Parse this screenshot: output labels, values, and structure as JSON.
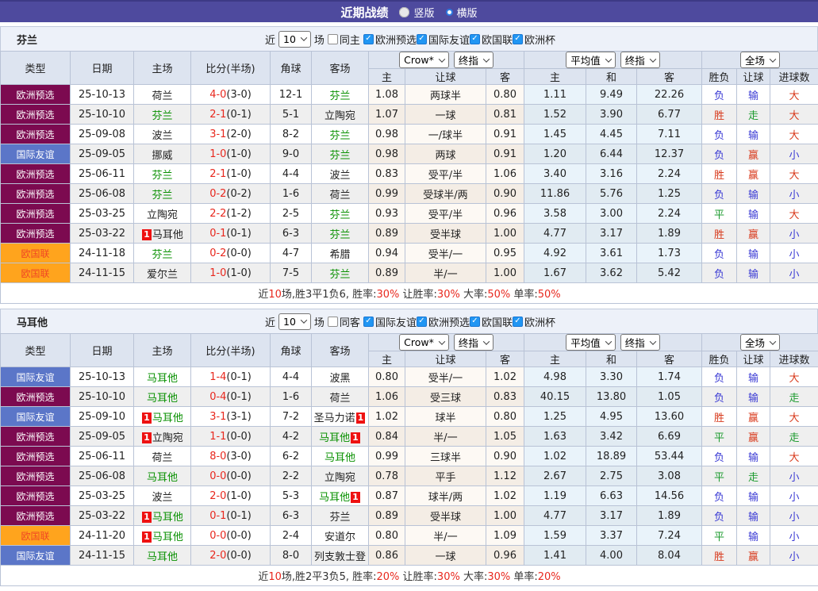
{
  "title_bar": {
    "title": "近期战绩",
    "radios": [
      {
        "label": "竖版",
        "selected": true
      },
      {
        "label": "横版",
        "selected": false
      }
    ]
  },
  "colors": {
    "titlebar_bg": "#4e4a9e",
    "checkbox_blue": "#2196f3",
    "score_red": "#e8281e",
    "team_green": "#089000",
    "badge_red": "#ee1111",
    "header_bg": "#dde4f0"
  },
  "palette": {
    "red": "#d8391b",
    "blue": "#3a3ad4",
    "green": "#1d9b2f"
  },
  "result_colors": {
    "胜": "red",
    "赢": "red",
    "大": "red",
    "负": "blue",
    "输": "blue",
    "小": "blue",
    "平": "green",
    "走": "green"
  },
  "league_styles": {
    "欧洲预选": {
      "bg": "#7c0a50",
      "fg": "#ffffff"
    },
    "国际友谊": {
      "bg": "#5b76c8",
      "fg": "#ffffff"
    },
    "欧国联": {
      "bg": "#ffa41d",
      "fg": "#f04724"
    }
  },
  "table_headers": {
    "cols": [
      "类型",
      "日期",
      "主场",
      "比分(半场)",
      "角球",
      "客场"
    ],
    "group1": {
      "selects": [
        "Crow*",
        "终指"
      ],
      "cols": [
        "主",
        "让球",
        "客"
      ]
    },
    "group2": {
      "selects": [
        "平均值",
        "终指"
      ],
      "cols": [
        "主",
        "和",
        "客"
      ]
    },
    "group3": {
      "selects": [
        "全场"
      ],
      "cols": [
        "胜负",
        "让球",
        "进球数"
      ]
    }
  },
  "tables": [
    {
      "team": "芬兰",
      "filter": {
        "near": "近",
        "count": "10",
        "games": "场",
        "same": "同主",
        "leagues": [
          "欧洲预选",
          "国际友谊",
          "欧国联",
          "欧洲杯"
        ]
      },
      "rows": [
        {
          "lg": "欧洲预选",
          "d": "25-10-13",
          "h": {
            "n": "荷兰"
          },
          "s": "4-0",
          "sh": "(3-0)",
          "c": "12-1",
          "a": {
            "n": "芬兰",
            "g": 1
          },
          "o": [
            "1.08",
            "两球半",
            "0.80"
          ],
          "v": [
            "1.11",
            "9.49",
            "22.26"
          ],
          "r": [
            "负",
            "输",
            "大"
          ]
        },
        {
          "lg": "欧洲预选",
          "d": "25-10-10",
          "h": {
            "n": "芬兰",
            "g": 1
          },
          "s": "2-1",
          "sh": "(0-1)",
          "c": "5-1",
          "a": {
            "n": "立陶宛"
          },
          "o": [
            "1.07",
            "一球",
            "0.81"
          ],
          "v": [
            "1.52",
            "3.90",
            "6.77"
          ],
          "r": [
            "胜",
            "走",
            "大"
          ]
        },
        {
          "lg": "欧洲预选",
          "d": "25-09-08",
          "h": {
            "n": "波兰"
          },
          "s": "3-1",
          "sh": "(2-0)",
          "c": "8-2",
          "a": {
            "n": "芬兰",
            "g": 1
          },
          "o": [
            "0.98",
            "一/球半",
            "0.91"
          ],
          "v": [
            "1.45",
            "4.45",
            "7.11"
          ],
          "r": [
            "负",
            "输",
            "大"
          ]
        },
        {
          "lg": "国际友谊",
          "d": "25-09-05",
          "h": {
            "n": "挪威"
          },
          "s": "1-0",
          "sh": "(1-0)",
          "c": "9-0",
          "a": {
            "n": "芬兰",
            "g": 1
          },
          "o": [
            "0.98",
            "两球",
            "0.91"
          ],
          "v": [
            "1.20",
            "6.44",
            "12.37"
          ],
          "r": [
            "负",
            "赢",
            "小"
          ]
        },
        {
          "lg": "欧洲预选",
          "d": "25-06-11",
          "h": {
            "n": "芬兰",
            "g": 1
          },
          "s": "2-1",
          "sh": "(1-0)",
          "c": "4-4",
          "a": {
            "n": "波兰"
          },
          "o": [
            "0.83",
            "受平/半",
            "1.06"
          ],
          "v": [
            "3.40",
            "3.16",
            "2.24"
          ],
          "r": [
            "胜",
            "赢",
            "大"
          ]
        },
        {
          "lg": "欧洲预选",
          "d": "25-06-08",
          "h": {
            "n": "芬兰",
            "g": 1
          },
          "s": "0-2",
          "sh": "(0-2)",
          "c": "1-6",
          "a": {
            "n": "荷兰"
          },
          "o": [
            "0.99",
            "受球半/两",
            "0.90"
          ],
          "v": [
            "11.86",
            "5.76",
            "1.25"
          ],
          "r": [
            "负",
            "输",
            "小"
          ]
        },
        {
          "lg": "欧洲预选",
          "d": "25-03-25",
          "h": {
            "n": "立陶宛"
          },
          "s": "2-2",
          "sh": "(1-2)",
          "c": "2-5",
          "a": {
            "n": "芬兰",
            "g": 1
          },
          "o": [
            "0.93",
            "受平/半",
            "0.96"
          ],
          "v": [
            "3.58",
            "3.00",
            "2.24"
          ],
          "r": [
            "平",
            "输",
            "大"
          ]
        },
        {
          "lg": "欧洲预选",
          "d": "25-03-22",
          "h": {
            "n": "马耳他",
            "pre": "1"
          },
          "s": "0-1",
          "sh": "(0-1)",
          "c": "6-3",
          "a": {
            "n": "芬兰",
            "g": 1
          },
          "o": [
            "0.89",
            "受半球",
            "1.00"
          ],
          "v": [
            "4.77",
            "3.17",
            "1.89"
          ],
          "r": [
            "胜",
            "赢",
            "小"
          ]
        },
        {
          "lg": "欧国联",
          "d": "24-11-18",
          "h": {
            "n": "芬兰",
            "g": 1
          },
          "s": "0-2",
          "sh": "(0-0)",
          "c": "4-7",
          "a": {
            "n": "希腊"
          },
          "o": [
            "0.94",
            "受半/一",
            "0.95"
          ],
          "v": [
            "4.92",
            "3.61",
            "1.73"
          ],
          "r": [
            "负",
            "输",
            "小"
          ]
        },
        {
          "lg": "欧国联",
          "d": "24-11-15",
          "h": {
            "n": "爱尔兰"
          },
          "s": "1-0",
          "sh": "(1-0)",
          "c": "7-5",
          "a": {
            "n": "芬兰",
            "g": 1
          },
          "o": [
            "0.89",
            "半/一",
            "1.00"
          ],
          "v": [
            "1.67",
            "3.62",
            "5.42"
          ],
          "r": [
            "负",
            "输",
            "小"
          ]
        }
      ],
      "summary": [
        {
          "t": "近",
          "r": 0
        },
        {
          "t": "10",
          "r": 1
        },
        {
          "t": "场,胜3平1负6, 胜率:",
          "r": 0
        },
        {
          "t": "30%",
          "r": 1
        },
        {
          "t": " 让胜率:",
          "r": 0
        },
        {
          "t": "30%",
          "r": 1
        },
        {
          "t": " 大率:",
          "r": 0
        },
        {
          "t": "50%",
          "r": 1
        },
        {
          "t": " 单率:",
          "r": 0
        },
        {
          "t": "50%",
          "r": 1
        }
      ]
    },
    {
      "team": "马耳他",
      "filter": {
        "near": "近",
        "count": "10",
        "games": "场",
        "same": "同客",
        "leagues": [
          "国际友谊",
          "欧洲预选",
          "欧国联",
          "欧洲杯"
        ]
      },
      "rows": [
        {
          "lg": "国际友谊",
          "d": "25-10-13",
          "h": {
            "n": "马耳他",
            "g": 1
          },
          "s": "1-4",
          "sh": "(0-1)",
          "c": "4-4",
          "a": {
            "n": "波黑"
          },
          "o": [
            "0.80",
            "受半/一",
            "1.02"
          ],
          "v": [
            "4.98",
            "3.30",
            "1.74"
          ],
          "r": [
            "负",
            "输",
            "大"
          ]
        },
        {
          "lg": "欧洲预选",
          "d": "25-10-10",
          "h": {
            "n": "马耳他",
            "g": 1
          },
          "s": "0-4",
          "sh": "(0-1)",
          "c": "1-6",
          "a": {
            "n": "荷兰"
          },
          "o": [
            "1.06",
            "受三球",
            "0.83"
          ],
          "v": [
            "40.15",
            "13.80",
            "1.05"
          ],
          "r": [
            "负",
            "输",
            "走"
          ]
        },
        {
          "lg": "国际友谊",
          "d": "25-09-10",
          "h": {
            "n": "马耳他",
            "g": 1,
            "pre": "1"
          },
          "s": "3-1",
          "sh": "(3-1)",
          "c": "7-2",
          "a": {
            "n": "圣马力诺",
            "post": "1"
          },
          "o": [
            "1.02",
            "球半",
            "0.80"
          ],
          "v": [
            "1.25",
            "4.95",
            "13.60"
          ],
          "r": [
            "胜",
            "赢",
            "大"
          ]
        },
        {
          "lg": "欧洲预选",
          "d": "25-09-05",
          "h": {
            "n": "立陶宛",
            "pre": "1"
          },
          "s": "1-1",
          "sh": "(0-0)",
          "c": "4-2",
          "a": {
            "n": "马耳他",
            "g": 1,
            "post": "1"
          },
          "o": [
            "0.84",
            "半/一",
            "1.05"
          ],
          "v": [
            "1.63",
            "3.42",
            "6.69"
          ],
          "r": [
            "平",
            "赢",
            "走"
          ]
        },
        {
          "lg": "欧洲预选",
          "d": "25-06-11",
          "h": {
            "n": "荷兰"
          },
          "s": "8-0",
          "sh": "(3-0)",
          "c": "6-2",
          "a": {
            "n": "马耳他",
            "g": 1
          },
          "o": [
            "0.99",
            "三球半",
            "0.90"
          ],
          "v": [
            "1.02",
            "18.89",
            "53.44"
          ],
          "r": [
            "负",
            "输",
            "大"
          ]
        },
        {
          "lg": "欧洲预选",
          "d": "25-06-08",
          "h": {
            "n": "马耳他",
            "g": 1
          },
          "s": "0-0",
          "sh": "(0-0)",
          "c": "2-2",
          "a": {
            "n": "立陶宛"
          },
          "o": [
            "0.78",
            "平手",
            "1.12"
          ],
          "v": [
            "2.67",
            "2.75",
            "3.08"
          ],
          "r": [
            "平",
            "走",
            "小"
          ]
        },
        {
          "lg": "欧洲预选",
          "d": "25-03-25",
          "h": {
            "n": "波兰"
          },
          "s": "2-0",
          "sh": "(1-0)",
          "c": "5-3",
          "a": {
            "n": "马耳他",
            "g": 1,
            "post": "1"
          },
          "o": [
            "0.87",
            "球半/两",
            "1.02"
          ],
          "v": [
            "1.19",
            "6.63",
            "14.56"
          ],
          "r": [
            "负",
            "输",
            "小"
          ]
        },
        {
          "lg": "欧洲预选",
          "d": "25-03-22",
          "h": {
            "n": "马耳他",
            "g": 1,
            "pre": "1"
          },
          "s": "0-1",
          "sh": "(0-1)",
          "c": "6-3",
          "a": {
            "n": "芬兰"
          },
          "o": [
            "0.89",
            "受半球",
            "1.00"
          ],
          "v": [
            "4.77",
            "3.17",
            "1.89"
          ],
          "r": [
            "负",
            "输",
            "小"
          ]
        },
        {
          "lg": "欧国联",
          "d": "24-11-20",
          "h": {
            "n": "马耳他",
            "g": 1,
            "pre": "1"
          },
          "s": "0-0",
          "sh": "(0-0)",
          "c": "2-4",
          "a": {
            "n": "安道尔"
          },
          "o": [
            "0.80",
            "半/一",
            "1.09"
          ],
          "v": [
            "1.59",
            "3.37",
            "7.24"
          ],
          "r": [
            "平",
            "输",
            "小"
          ]
        },
        {
          "lg": "国际友谊",
          "d": "24-11-15",
          "h": {
            "n": "马耳他",
            "g": 1
          },
          "s": "2-0",
          "sh": "(0-0)",
          "c": "8-0",
          "a": {
            "n": "列支敦士登"
          },
          "o": [
            "0.86",
            "一球",
            "0.96"
          ],
          "v": [
            "1.41",
            "4.00",
            "8.04"
          ],
          "r": [
            "胜",
            "赢",
            "小"
          ]
        }
      ],
      "summary": [
        {
          "t": "近",
          "r": 0
        },
        {
          "t": "10",
          "r": 1
        },
        {
          "t": "场,胜2平3负5, 胜率:",
          "r": 0
        },
        {
          "t": "20%",
          "r": 1
        },
        {
          "t": " 让胜率:",
          "r": 0
        },
        {
          "t": "30%",
          "r": 1
        },
        {
          "t": " 大率:",
          "r": 0
        },
        {
          "t": "30%",
          "r": 1
        },
        {
          "t": " 单率:",
          "r": 0
        },
        {
          "t": "20%",
          "r": 1
        }
      ]
    }
  ]
}
